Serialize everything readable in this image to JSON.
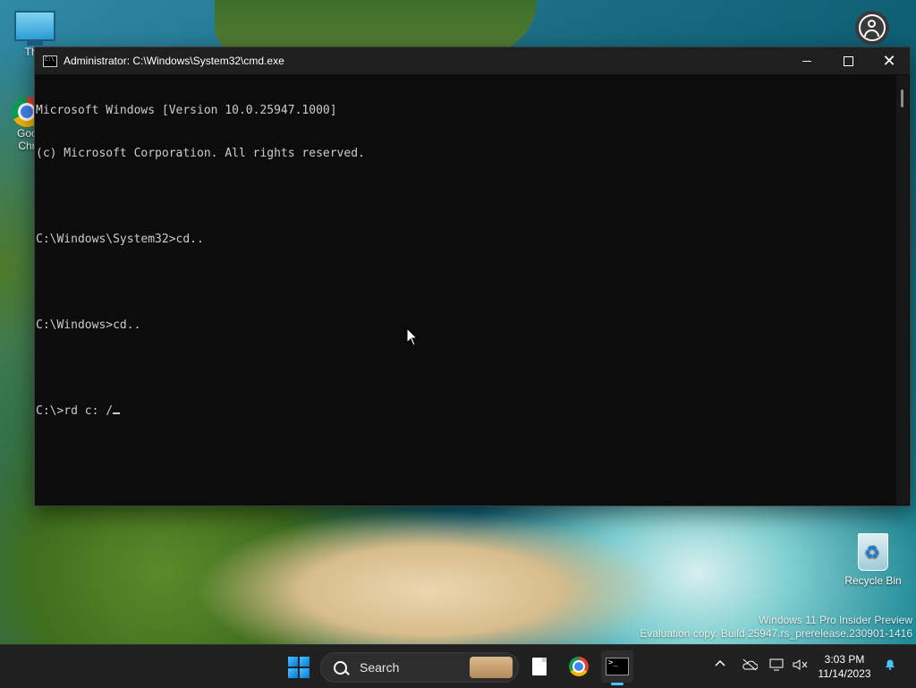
{
  "desktop": {
    "this_pc_label": "This",
    "chrome_label_line1": "Goc",
    "chrome_label_line2": "Chr",
    "recycle_bin_label": "Recycle Bin",
    "watermark_line1": "Windows 11 Pro Insider Preview",
    "watermark_line2": "Evaluation copy. Build 25947.rs_prerelease.230901-1416"
  },
  "window": {
    "title": "Administrator: C:\\Windows\\System32\\cmd.exe",
    "lines": [
      "Microsoft Windows [Version 10.0.25947.1000]",
      "(c) Microsoft Corporation. All rights reserved.",
      "",
      "C:\\Windows\\System32>cd..",
      "",
      "C:\\Windows>cd..",
      "",
      "C:\\>rd c: /"
    ]
  },
  "taskbar": {
    "search_label": "Search",
    "time": "3:03 PM",
    "date": "11/14/2023",
    "accent_color": "#4cc2ff"
  },
  "icons": {
    "start": "windows-logo-icon",
    "search": "search-icon",
    "file": "file-icon",
    "browser": "chrome-icon",
    "terminal": "terminal-icon",
    "tray_chevron": "chevron-up-icon",
    "network": "network-off-icon",
    "display": "display-icon",
    "volume": "volume-muted-icon",
    "notifications": "bell-icon"
  }
}
